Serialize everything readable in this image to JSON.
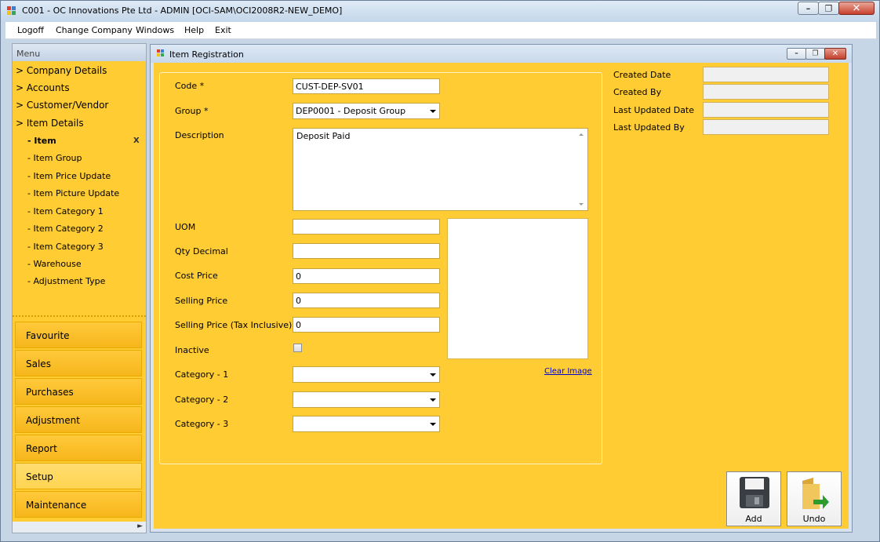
{
  "window": {
    "title": "C001 - OC Innovations Pte Ltd - ADMIN [OCI-SAM\\OCI2008R2-NEW_DEMO]"
  },
  "menubar": {
    "items": [
      "Logoff",
      "Change Company",
      "Windows",
      "Help",
      "Exit"
    ]
  },
  "sidebar": {
    "header": "Menu",
    "tree": [
      {
        "label": "> Company Details"
      },
      {
        "label": "> Accounts"
      },
      {
        "label": "> Customer/Vendor"
      },
      {
        "label": "> Item Details"
      }
    ],
    "subitems": [
      {
        "label": "- Item"
      },
      {
        "label": "- Item Group"
      },
      {
        "label": "- Item Price Update"
      },
      {
        "label": "- Item Picture Update"
      },
      {
        "label": "- Item Category 1"
      },
      {
        "label": "- Item Category 2"
      },
      {
        "label": "- Item Category 3"
      },
      {
        "label": "- Warehouse"
      },
      {
        "label": "- Adjustment Type"
      }
    ],
    "active_close": "X",
    "nav_buttons": [
      "Favourite",
      "Sales",
      "Purchases",
      "Adjustment",
      "Report",
      "Setup",
      "Maintenance"
    ],
    "selected_nav": "Setup"
  },
  "child_window": {
    "title": "Item Registration"
  },
  "form": {
    "code": {
      "label": "Code *",
      "value": "CUST-DEP-SV01"
    },
    "group": {
      "label": "Group *",
      "value": "DEP0001 - Deposit Group"
    },
    "description": {
      "label": "Description",
      "value": "Deposit Paid"
    },
    "uom": {
      "label": "UOM",
      "value": ""
    },
    "qty_decimal": {
      "label": "Qty Decimal",
      "value": ""
    },
    "cost_price": {
      "label": "Cost Price",
      "value": "0"
    },
    "selling_price": {
      "label": "Selling Price",
      "value": "0"
    },
    "selling_price_tax": {
      "label": "Selling Price (Tax Inclusive)",
      "value": "0"
    },
    "inactive": {
      "label": "Inactive",
      "checked": false
    },
    "category1": {
      "label": "Category - 1",
      "value": ""
    },
    "category2": {
      "label": "Category - 2",
      "value": ""
    },
    "category3": {
      "label": "Category - 3",
      "value": ""
    },
    "clear_image": "Clear Image"
  },
  "audit": {
    "created_date": {
      "label": "Created Date",
      "value": ""
    },
    "created_by": {
      "label": "Created By",
      "value": ""
    },
    "last_updated_date": {
      "label": "Last Updated Date",
      "value": ""
    },
    "last_updated_by": {
      "label": "Last Updated By",
      "value": ""
    }
  },
  "actions": {
    "add": "Add",
    "undo": "Undo"
  },
  "colors": {
    "form_background": "#ffcc33",
    "window_chrome": "#c7d6e6",
    "link": "#0000cc"
  }
}
